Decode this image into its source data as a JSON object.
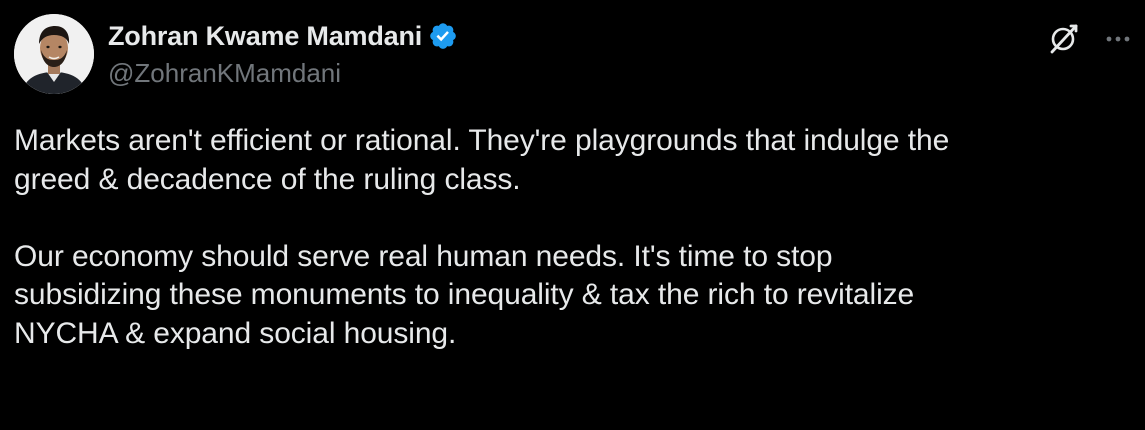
{
  "tweet": {
    "author": {
      "display_name": "Zohran Kwame Mamdani",
      "handle": "@ZohranKMamdani",
      "verified": true,
      "verified_color": "#1d9bf0"
    },
    "icons": {
      "grok": "grok-icon",
      "more": "more-icon"
    },
    "paragraphs": [
      {
        "lines": [
          "Markets aren't efficient or rational. They're playgrounds that indulge the",
          "greed & decadence of the ruling class."
        ]
      },
      {
        "lines": [
          "Our economy should serve real human needs. It's time to stop",
          "subsidizing these monuments to inequality & tax the rich to revitalize",
          "NYCHA & expand social housing."
        ]
      }
    ]
  },
  "colors": {
    "background": "#000000",
    "text": "#e7e9ea",
    "secondary": "#71767b",
    "accent": "#1d9bf0"
  }
}
